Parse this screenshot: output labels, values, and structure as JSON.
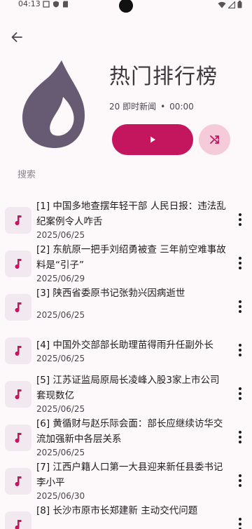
{
  "status_bar": {
    "time": "04:13"
  },
  "header": {
    "title": "热门排行榜",
    "count": "20 即时新闻",
    "separator": "•",
    "duration": "00:00"
  },
  "search": {
    "label": "搜索"
  },
  "colors": {
    "accent": "#c4155f",
    "accent_light": "#f5cbd9",
    "flame": "#665b72"
  },
  "items": [
    {
      "title": "[1] 中国多地查摆年轻干部 人民日报：违法乱纪案例令人咋舌",
      "date": "2025/06/25"
    },
    {
      "title": "[2] 东航原一把手刘绍勇被查 三年前空难事故料是“引子”",
      "date": "2025/06/29"
    },
    {
      "title": "[3] 陕西省委原书记张勃兴因病逝世",
      "date": "2025/06/25"
    },
    {
      "title": "[4] 中国外交部部长助理苗得雨升任副外长",
      "date": "2025/06/25"
    },
    {
      "title": "[5] 江苏证监局原局长凌峰入股3家上市公司套现数亿",
      "date": "2025/06/25"
    },
    {
      "title": "[6] 黄循财与赵乐际会面：部长应继续访华交流加强新中各层关系",
      "date": "2025/06/25"
    },
    {
      "title": "[7] 江西户籍人口第一大县迎来新任县委书记李小平",
      "date": "2025/06/30"
    },
    {
      "title": "[8] 长沙市原市长郑建新 主动交代问题",
      "date": ""
    }
  ]
}
